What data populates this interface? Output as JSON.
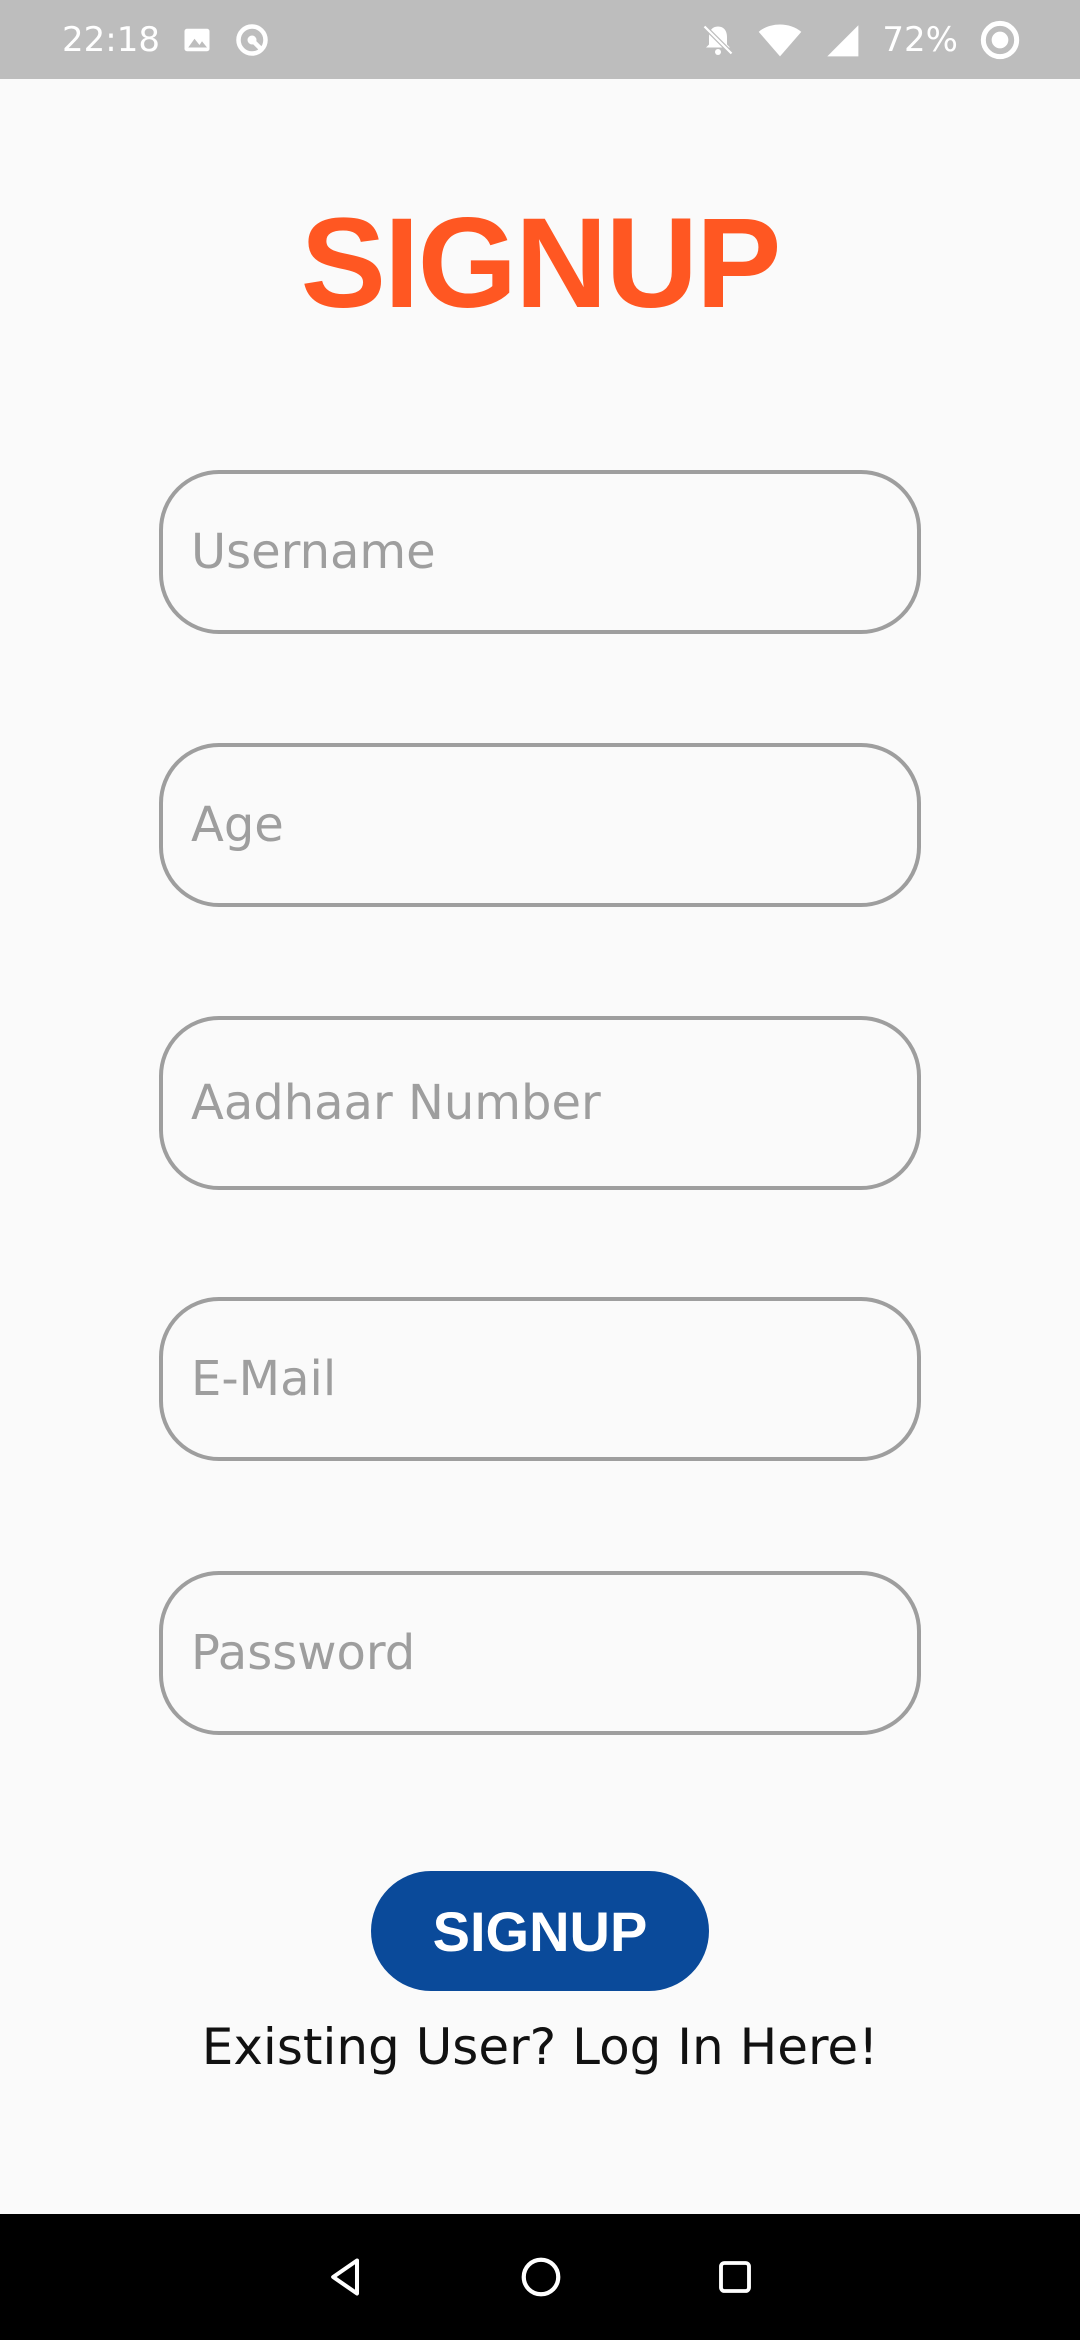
{
  "status_bar": {
    "time": "22:18",
    "battery": "72%",
    "icons": [
      "image-icon",
      "sync-icon",
      "notifications-off-icon",
      "wifi-icon",
      "signal-icon",
      "battery-saver-icon"
    ]
  },
  "page": {
    "title": "SIGNUP"
  },
  "form": {
    "username_placeholder": "Username",
    "age_placeholder": "Age",
    "aadhaar_placeholder": "Aadhaar Number",
    "email_placeholder": "E-Mail",
    "password_placeholder": "Password",
    "submit_label": "SIGNUP",
    "login_link": "Existing User? Log In Here!"
  },
  "nav_bar": {
    "icons": [
      "back-icon",
      "home-icon",
      "recents-icon"
    ]
  },
  "colors": {
    "title": "#ff5722",
    "button": "#0a4a9a",
    "border": "#9e9e9e",
    "status_bar": "#bdbdbd",
    "background": "#fafafa"
  }
}
